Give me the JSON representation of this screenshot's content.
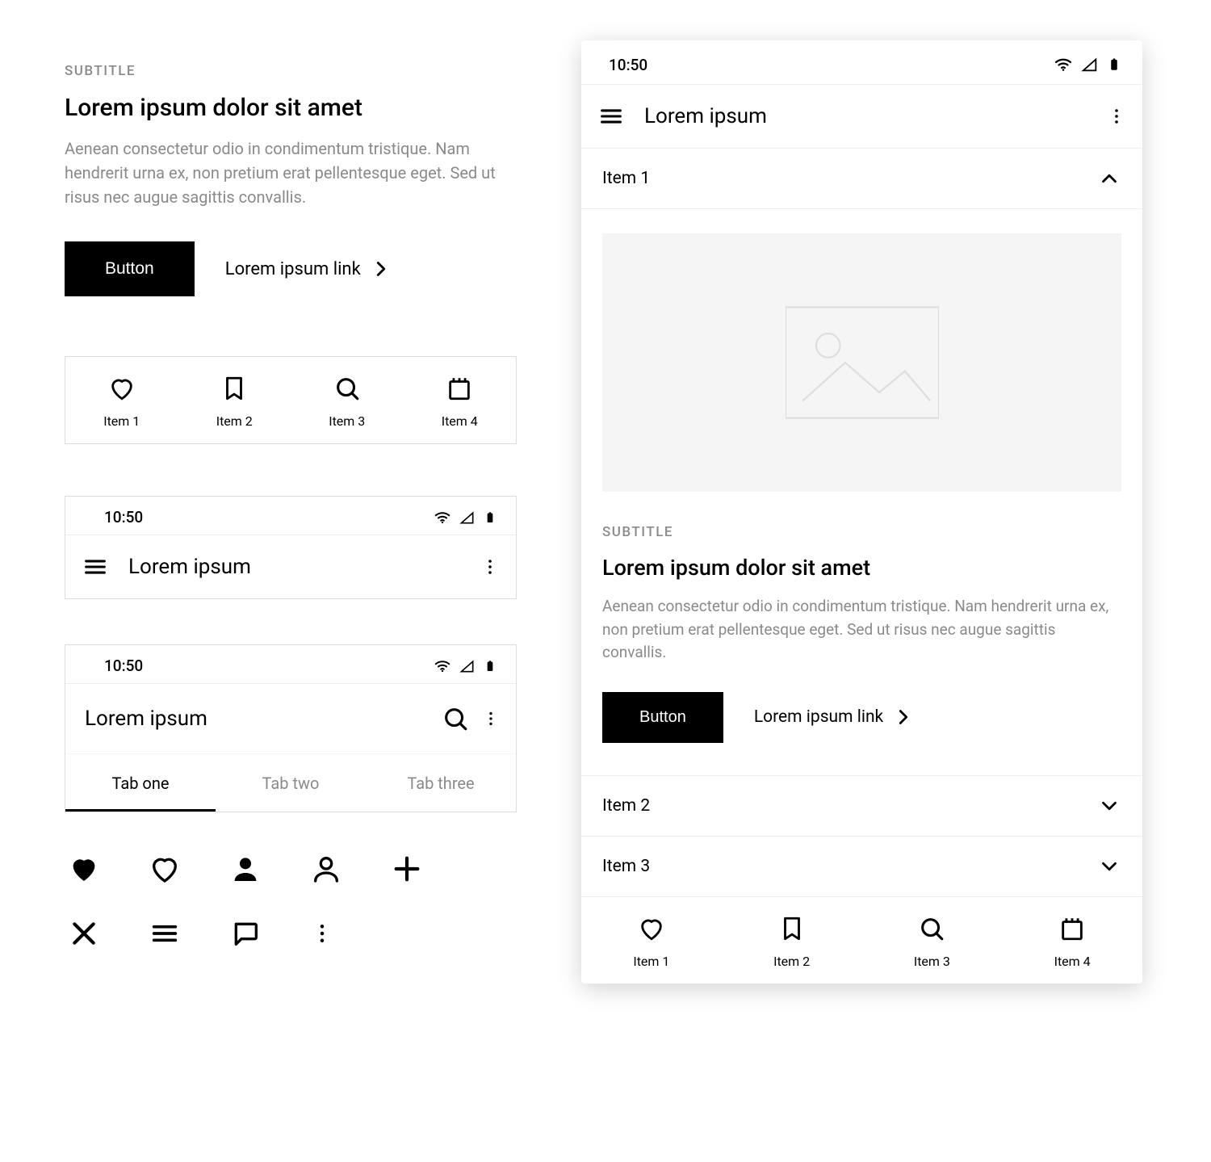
{
  "content_block": {
    "subtitle": "SUBTITLE",
    "title": "Lorem ipsum dolor sit amet",
    "body": "Aenean consectetur odio in condimentum tristique. Nam hendrerit urna ex, non pretium erat pellentesque eget. Sed ut risus nec augue sagittis convallis.",
    "button_label": "Button",
    "link_label": "Lorem ipsum link"
  },
  "bottom_nav": {
    "items": [
      {
        "label": "Item 1",
        "icon": "heart-outline"
      },
      {
        "label": "Item 2",
        "icon": "bookmark-outline"
      },
      {
        "label": "Item 3",
        "icon": "search"
      },
      {
        "label": "Item 4",
        "icon": "calendar"
      }
    ]
  },
  "status_bar": {
    "time": "10:50"
  },
  "app_bar_simple": {
    "title": "Lorem ipsum"
  },
  "app_bar_tabs": {
    "title": "Lorem ipsum",
    "tabs": [
      {
        "label": "Tab one",
        "active": true
      },
      {
        "label": "Tab two",
        "active": false
      },
      {
        "label": "Tab three",
        "active": false
      }
    ]
  },
  "icon_grid": {
    "row1": [
      "heart-filled",
      "heart-outline",
      "user-filled",
      "user-outline",
      "plus"
    ],
    "row2": [
      "close",
      "menu",
      "speech-bubble",
      "more-vert"
    ]
  },
  "phone_screen": {
    "status_time": "10:50",
    "app_title": "Lorem ipsum",
    "accordion": {
      "items": [
        {
          "label": "Item 1",
          "expanded": true
        },
        {
          "label": "Item 2",
          "expanded": false
        },
        {
          "label": "Item 3",
          "expanded": false
        }
      ],
      "expanded_content": {
        "subtitle": "SUBTITLE",
        "title": "Lorem ipsum dolor sit amet",
        "body": "Aenean consectetur odio in condimentum tristique. Nam hendrerit urna ex, non pretium erat pellentesque eget. Sed ut risus nec augue sagittis convallis.",
        "button_label": "Button",
        "link_label": "Lorem ipsum link"
      }
    },
    "bottom_nav": {
      "items": [
        {
          "label": "Item 1",
          "icon": "heart-outline"
        },
        {
          "label": "Item 2",
          "icon": "bookmark-outline"
        },
        {
          "label": "Item 3",
          "icon": "search"
        },
        {
          "label": "Item 4",
          "icon": "calendar"
        }
      ]
    }
  }
}
